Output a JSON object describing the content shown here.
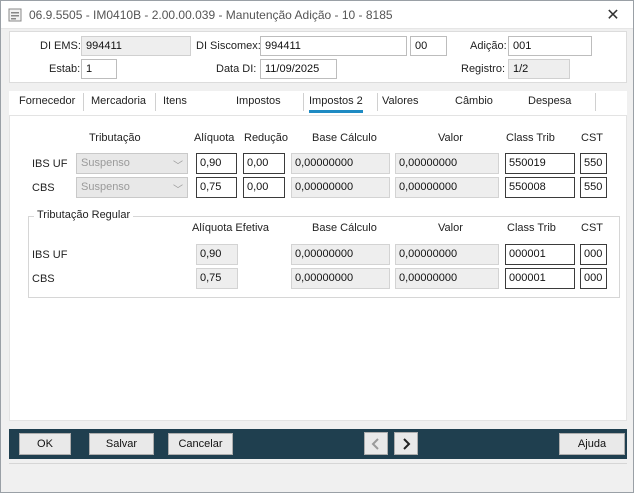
{
  "window": {
    "title": "06.9.5505 - IM0410B - 2.00.00.039 - Manutenção Adição - 10 - 8185",
    "close_glyph": "✕"
  },
  "header": {
    "di_ems_label": "DI EMS:",
    "di_ems_value": "994411",
    "di_siscomex_label": "DI Siscomex:",
    "di_siscomex_value": "994411",
    "di_siscomex_suffix": "00",
    "adicao_label": "Adição:",
    "adicao_value": "001",
    "estab_label": "Estab:",
    "estab_value": "1",
    "data_di_label": "Data DI:",
    "data_di_value": "11/09/2025",
    "registro_label": "Registro:",
    "registro_value": "1/2"
  },
  "tabs": [
    "Fornecedor",
    "Mercadoria",
    "Itens",
    "Impostos",
    "Impostos 2",
    "Valores",
    "Câmbio",
    "Despesa"
  ],
  "active_tab": "Impostos 2",
  "section1": {
    "headers": {
      "tributacao": "Tributação",
      "aliquota": "Alíquota",
      "reducao": "Redução",
      "base_calculo": "Base Cálculo",
      "valor": "Valor",
      "class_trib": "Class Trib",
      "cst": "CST"
    },
    "rows": [
      {
        "label": "IBS UF",
        "tributacao": "Suspenso",
        "aliquota": "0,90",
        "reducao": "0,00",
        "base_calculo": "0,00000000",
        "valor": "0,00000000",
        "class_trib": "550019",
        "cst": "550"
      },
      {
        "label": "CBS",
        "tributacao": "Suspenso",
        "aliquota": "0,75",
        "reducao": "0,00",
        "base_calculo": "0,00000000",
        "valor": "0,00000000",
        "class_trib": "550008",
        "cst": "550"
      }
    ]
  },
  "section2": {
    "title": "Tributação Regular",
    "headers": {
      "aliquota_efetiva": "Alíquota Efetiva",
      "base_calculo": "Base Cálculo",
      "valor": "Valor",
      "class_trib": "Class Trib",
      "cst": "CST"
    },
    "rows": [
      {
        "label": "IBS UF",
        "aliquota_efetiva": "0,90",
        "base_calculo": "0,00000000",
        "valor": "0,00000000",
        "class_trib": "000001",
        "cst": "000"
      },
      {
        "label": "CBS",
        "aliquota_efetiva": "0,75",
        "base_calculo": "0,00000000",
        "valor": "0,00000000",
        "class_trib": "000001",
        "cst": "000"
      }
    ]
  },
  "footer": {
    "ok": "OK",
    "salvar": "Salvar",
    "cancelar": "Cancelar",
    "ajuda": "Ajuda",
    "prev_icon": "chevron-left-icon",
    "next_icon": "chevron-right-icon"
  },
  "colors": {
    "footer_bg": "#1f3f4f",
    "active_tab_underline": "#1e8bc3"
  }
}
